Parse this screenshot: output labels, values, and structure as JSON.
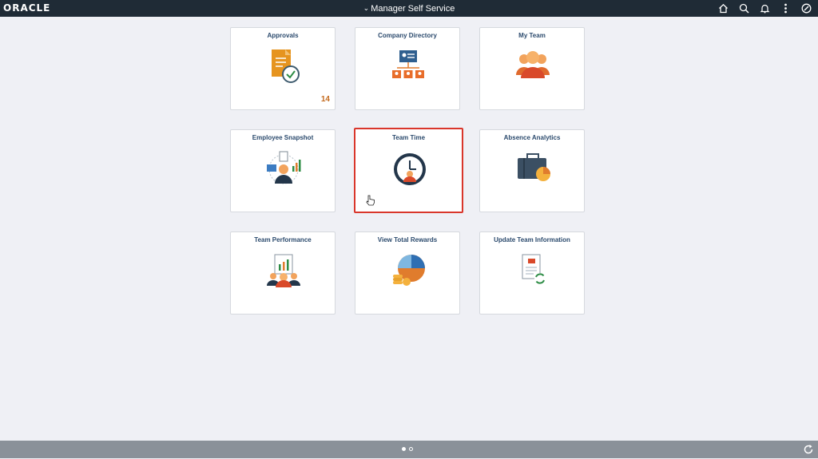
{
  "header": {
    "logo_text": "ORACLE",
    "homepage_title": "Manager Self Service",
    "homepage_chevron_icon": "chevron-down-icon",
    "icons": [
      "home-icon",
      "search-icon",
      "notifications-icon",
      "actions-menu-icon",
      "navbar-icon"
    ],
    "notification_count": ""
  },
  "tiles": [
    {
      "title": "Approvals",
      "count": "14",
      "icon": "approvals-icon"
    },
    {
      "title": "Company Directory",
      "icon": "company-directory-icon"
    },
    {
      "title": "My Team",
      "icon": "my-team-icon"
    },
    {
      "title": "Employee Snapshot",
      "icon": "employee-snapshot-icon"
    },
    {
      "title": "Team Time",
      "icon": "team-time-icon",
      "selected": true
    },
    {
      "title": "Absence Analytics",
      "icon": "absence-analytics-icon"
    },
    {
      "title": "Team Performance",
      "icon": "team-performance-icon"
    },
    {
      "title": "View Total Rewards",
      "icon": "total-rewards-icon"
    },
    {
      "title": "Update Team Information",
      "icon": "update-team-info-icon"
    }
  ],
  "footer": {
    "page_dots": 2,
    "active_page": 1,
    "refresh_icon": "refresh-icon"
  },
  "colors": {
    "topbar": "#1f2b36",
    "background": "#eff0f5",
    "tile_title": "#2b4a6d",
    "selected_border": "#d9362b",
    "count": "#c46b1f",
    "footer": "#8a9199"
  }
}
